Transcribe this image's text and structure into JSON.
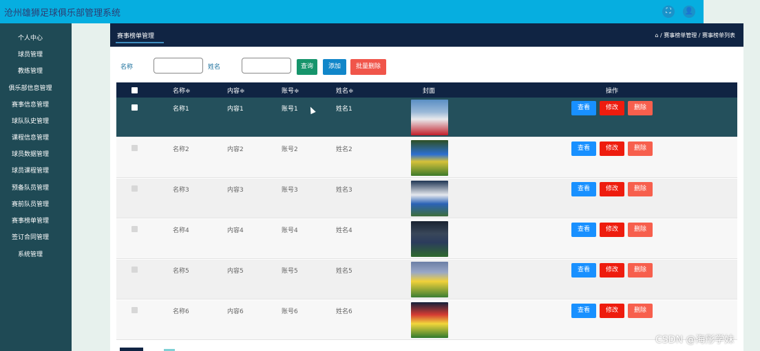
{
  "header": {
    "app_title": "沧州雄狮足球俱乐部管理系统",
    "icons": [
      "fullscreen-icon",
      "user-icon"
    ],
    "fullscreen_glyph": "⛶",
    "user_glyph": "👤"
  },
  "sidebar": {
    "items": [
      "个人中心",
      "球员管理",
      "教练管理",
      "俱乐部信息管理",
      "赛事信息管理",
      "球队队史管理",
      "课程信息管理",
      "球员数据管理",
      "球员课程管理",
      "预备队员管理",
      "赛前队员管理",
      "赛事榜单管理",
      "签订合同管理",
      "系统管理"
    ]
  },
  "panel": {
    "tab_title": "赛事榜单管理",
    "breadcrumb": "⌂ / 赛事榜单管理 / 赛事榜单列表"
  },
  "filters": {
    "name_label": "名称",
    "name_value": "",
    "xingming_label": "姓名",
    "xingming_value": ""
  },
  "buttons": {
    "search": "查询",
    "add": "添加",
    "batch_delete": "批量删除"
  },
  "table": {
    "columns": [
      "名称≑",
      "内容≑",
      "账号≑",
      "姓名≑",
      "封面",
      "操作"
    ],
    "rows": [
      {
        "mingcheng": "名称1",
        "neirong": "内容1",
        "zhanghao": "账号1",
        "xingming": "姓名1"
      },
      {
        "mingcheng": "名称2",
        "neirong": "内容2",
        "zhanghao": "账号2",
        "xingming": "姓名2"
      },
      {
        "mingcheng": "名称3",
        "neirong": "内容3",
        "zhanghao": "账号3",
        "xingming": "姓名3"
      },
      {
        "mingcheng": "名称4",
        "neirong": "内容4",
        "zhanghao": "账号4",
        "xingming": "姓名4"
      },
      {
        "mingcheng": "名称5",
        "neirong": "内容5",
        "zhanghao": "账号5",
        "xingming": "姓名5"
      },
      {
        "mingcheng": "名称6",
        "neirong": "内容6",
        "zhanghao": "账号6",
        "xingming": "姓名6"
      }
    ],
    "row_actions": {
      "view": "查看",
      "edit": "修改",
      "delete": "删除"
    }
  },
  "colors": {
    "topbar": "#06aee0",
    "sidebar": "#1f4a55",
    "panel_header": "#102443",
    "highlight_row": "#24505c",
    "search_button": "#16946b",
    "add_button": "#1186c9",
    "batch_delete_button": "#f0554a",
    "view_button": "#1890ff",
    "edit_button": "#ee1c0e",
    "delete_button": "#f75f4d"
  },
  "watermark": "CSDN @海彤学妹"
}
